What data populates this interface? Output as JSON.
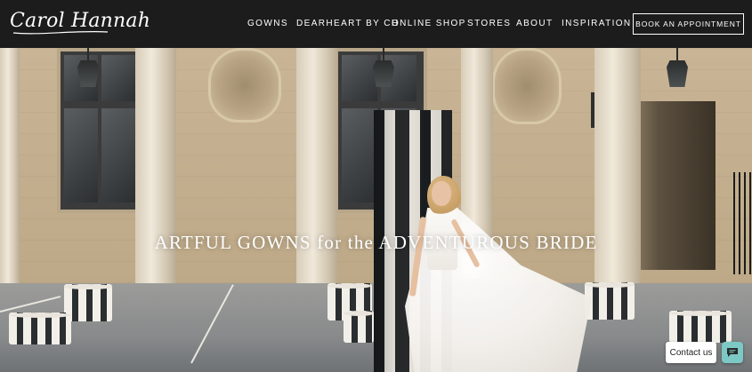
{
  "header": {
    "logo_text": "Carol Hannah",
    "nav": [
      "GOWNS",
      "DEARHEART BY CH",
      "ONLINE SHOP",
      "STORES",
      "ABOUT",
      "INSPIRATION"
    ],
    "cta_label": "BOOK AN APPOINTMENT"
  },
  "hero": {
    "headline": "ARTFUL GOWNS for the ADVENTUROUS BRIDE"
  },
  "chat": {
    "label": "Contact us",
    "icon": "chat-bubble-icon"
  },
  "colors": {
    "header_bg": "#1d1c1c",
    "chat_accent": "#7bc8c5"
  }
}
